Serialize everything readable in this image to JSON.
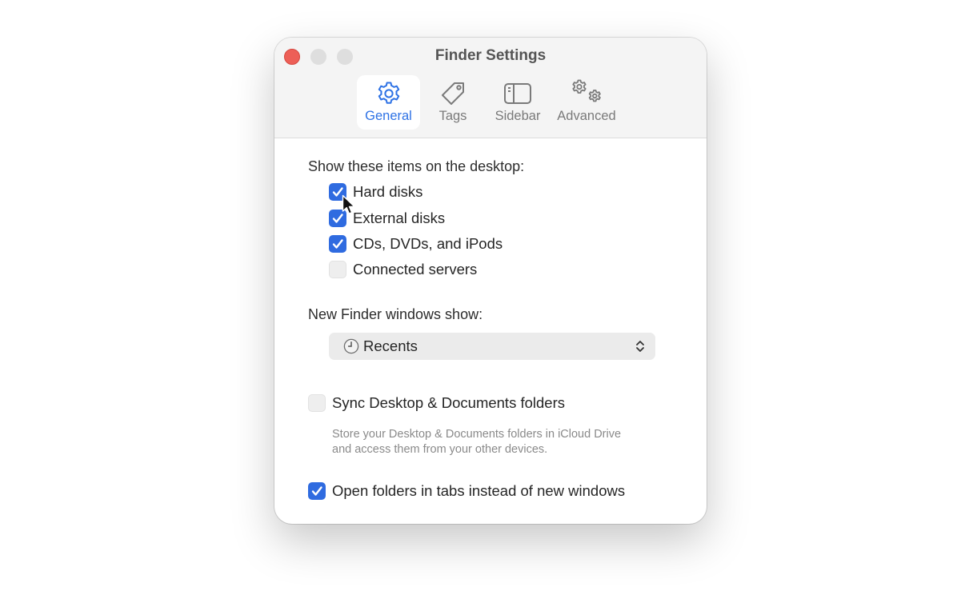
{
  "window": {
    "title": "Finder Settings"
  },
  "tabs": [
    {
      "label": "General",
      "icon": "gear-icon",
      "active": true
    },
    {
      "label": "Tags",
      "icon": "tag-icon",
      "active": false
    },
    {
      "label": "Sidebar",
      "icon": "sidebar-icon",
      "active": false
    },
    {
      "label": "Advanced",
      "icon": "gears-icon",
      "active": false
    }
  ],
  "desktop_items": {
    "heading": "Show these items on the desktop:",
    "options": [
      {
        "label": "Hard disks",
        "checked": true
      },
      {
        "label": "External disks",
        "checked": true
      },
      {
        "label": "CDs, DVDs, and iPods",
        "checked": true
      },
      {
        "label": "Connected servers",
        "checked": false
      }
    ]
  },
  "new_windows": {
    "heading": "New Finder windows show:",
    "selected": "Recents",
    "icon": "clock-icon"
  },
  "sync": {
    "label": "Sync Desktop & Documents folders",
    "checked": false,
    "description": "Store your Desktop & Documents folders in iCloud Drive and access them from your other devices."
  },
  "tabs_option": {
    "label": "Open folders in tabs instead of new windows",
    "checked": true
  },
  "colors": {
    "accent": "#2f6be0",
    "close_button": "#ed5f57"
  }
}
